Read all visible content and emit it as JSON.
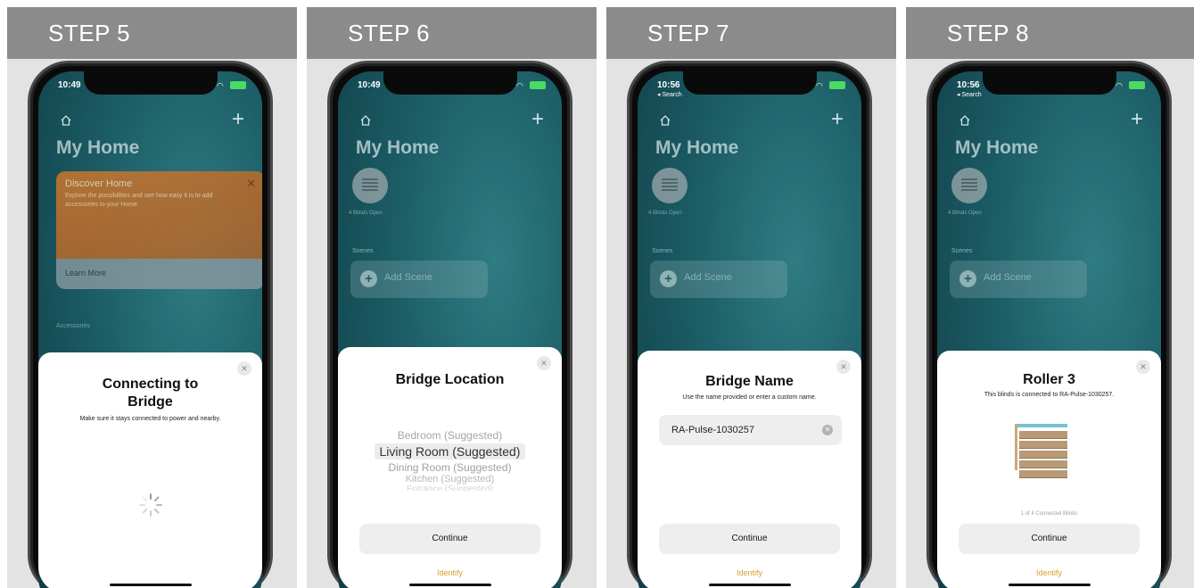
{
  "steps": [
    {
      "label": "STEP 5",
      "status_time": "10:49",
      "home_title": "My Home",
      "discover": {
        "title": "Discover Home",
        "text": "Explore the possibilities and see how easy it is to add accessories to your Home.",
        "learn_more": "Learn More"
      },
      "accessories_label": "Accessories",
      "sheet": {
        "title_line1": "Connecting to",
        "title_line2": "Bridge",
        "subtitle": "Make sure it stays connected to power and nearby."
      }
    },
    {
      "label": "STEP 6",
      "status_time": "10:49",
      "home_title": "My Home",
      "blinds_label": "4 Blinds Open",
      "scenes_label": "Scenes",
      "add_scene": "Add Scene",
      "sheet": {
        "title": "Bridge Location",
        "options": [
          "Bedroom (Suggested)",
          "Living Room (Suggested)",
          "Dining Room (Suggested)",
          "Kitchen (Suggested)",
          "Entrance (Suggested)"
        ],
        "continue": "Continue",
        "identify": "Identify"
      }
    },
    {
      "label": "STEP 7",
      "status_time": "10:56",
      "status_back": "◂ Search",
      "home_title": "My Home",
      "blinds_label": "4 Blinds Open",
      "scenes_label": "Scenes",
      "add_scene": "Add Scene",
      "sheet": {
        "title": "Bridge Name",
        "subtitle": "Use the name provided or enter a custom name.",
        "name_value": "RA-Pulse-1030257",
        "continue": "Continue",
        "identify": "Identify"
      }
    },
    {
      "label": "STEP 8",
      "status_time": "10:56",
      "status_back": "◂ Search",
      "home_title": "My Home",
      "blinds_label": "4 Blinds Open",
      "scenes_label": "Scenes",
      "add_scene": "Add Scene",
      "sheet": {
        "title": "Roller 3",
        "subtitle": "This blinds is connected to RA-Pulse-1030257.",
        "counter": "1 of 4 Connected Blinds",
        "continue": "Continue",
        "identify": "Identify"
      }
    }
  ],
  "colors": {
    "header_bg": "#8b8b8b",
    "identify": "#d9a02c",
    "screen_teal": "#1c5d66"
  }
}
